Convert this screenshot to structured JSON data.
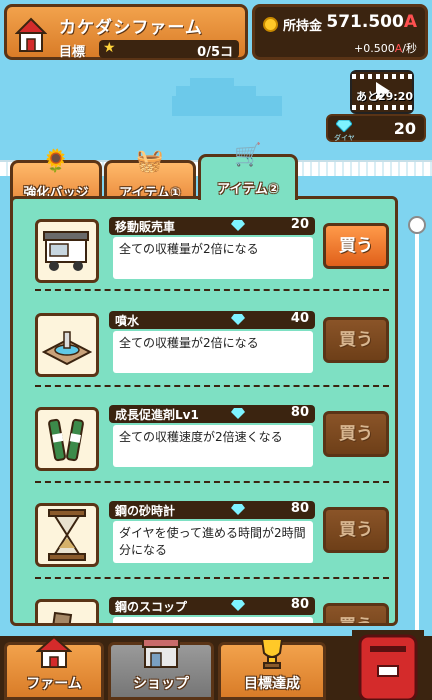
{
  "header": {
    "farm_name": "カケダシファーム",
    "goal_label": "目標",
    "goal_count": "0/5コ",
    "money_label": "所持金",
    "money_value": "571.500",
    "money_unit": "A",
    "money_rate_prefix": "+0.500",
    "money_rate_unit": "A",
    "money_rate_suffix": "/秒"
  },
  "video": {
    "time_label": "あと29:20"
  },
  "diamond": {
    "label": "ダイヤ",
    "value": "20"
  },
  "tabs": [
    {
      "label": "強化バッジ"
    },
    {
      "label": "アイテム①"
    },
    {
      "label": "アイテム②"
    }
  ],
  "items": [
    {
      "name": "移動販売車",
      "price": "20",
      "desc": "全ての収穫量が2倍になる",
      "buy": "買う"
    },
    {
      "name": "噴水",
      "price": "40",
      "desc": "全ての収穫量が2倍になる",
      "buy": "買う"
    },
    {
      "name": "成長促進剤Lv1",
      "price": "80",
      "desc": "全ての収穫速度が2倍速くなる",
      "buy": "買う"
    },
    {
      "name": "鋼の砂時計",
      "price": "80",
      "desc": "ダイヤを使って進める時間が2時間分になる",
      "buy": "買う"
    },
    {
      "name": "鋼のスコップ",
      "price": "80",
      "desc": "",
      "buy": "買う"
    }
  ],
  "nav": [
    {
      "label": "ファーム"
    },
    {
      "label": "ショップ"
    },
    {
      "label": "目標達成"
    }
  ],
  "colors": {
    "sky": "#7fd4f0",
    "panel": "#7ee0c3",
    "dark_brown": "#3b2410",
    "accent_red": "#ff5050"
  }
}
